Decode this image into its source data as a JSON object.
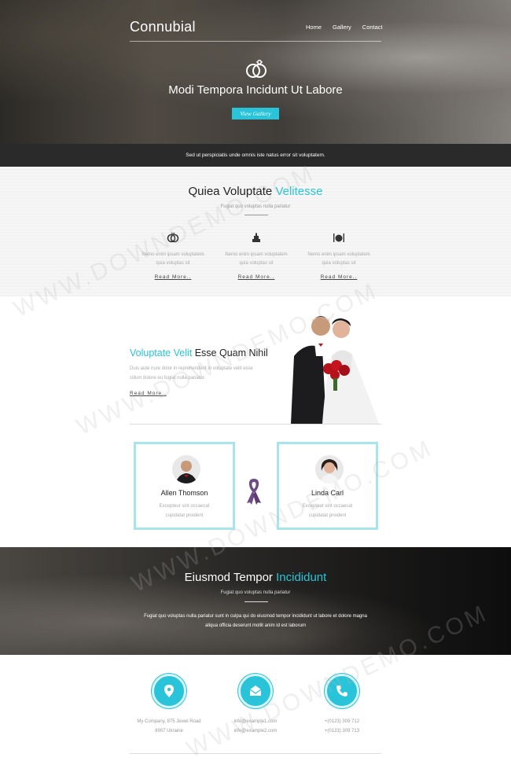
{
  "header": {
    "brand": "Connubial",
    "nav": [
      "Home",
      "Gallery",
      "Contact"
    ],
    "title": "Modi Tempora Incidunt Ut Labore",
    "button": "View Gallery",
    "tagline": "Sed ut perspiciatis unde omnis iste natus error sit voluptatem."
  },
  "services": {
    "title_main": "Quiea Voluptate",
    "title_accent": "Velitesse",
    "subtitle": "Fugiat quo voluptas nulla pariatur",
    "items": [
      {
        "icon": "rings-icon",
        "text_1": "Nemo enim ipsam voluptatem",
        "text_2": "quia voluptas sit",
        "link": "Read More.."
      },
      {
        "icon": "cake-icon",
        "text_1": "Nemo enim ipsam voluptatem",
        "text_2": "quia voluptas sit",
        "link": "Read More.."
      },
      {
        "icon": "dining-icon",
        "text_1": "Nemo enim ipsam voluptatem",
        "text_2": "quia voluptas sit",
        "link": "Read More.."
      }
    ]
  },
  "about": {
    "title_accent": "Voluptate Velit",
    "title_main": "Esse Quam Nihil",
    "text_1": "Duis aute irure dolor in reprehenderit in voluptate velit esse",
    "text_2": "cillum dolore eu fugiat nulla pariatur.",
    "link": "Read More.."
  },
  "profiles": [
    {
      "name": "Allen Thomson",
      "text_1": "Excepteur sint occaecat",
      "text_2": "cupidatat proident"
    },
    {
      "name": "Linda Carl",
      "text_1": "Excepteur sint occaecat",
      "text_2": "cupidatat proident"
    }
  ],
  "event": {
    "title_main": "Eiusmod Tempor",
    "title_accent": "Incididunt",
    "subtitle": "Fugiat quo voluptas nulla pariatur",
    "text_1": "Fugiat quo voluptas nulla pariatur sunt in culpa qui do eiusmod tempor incididunt ut labore et dolore magna",
    "text_2": "aliqua officia deserunt mollit anim id est laborum"
  },
  "contact": {
    "address_1": "My Company, 875 Jewel Road",
    "address_2": "8907 Ukraine",
    "email_1": "info@example1.com",
    "email_2": "info@example2.com",
    "phone_1": "+(0123) 309 712",
    "phone_2": "+(0123) 309 713"
  },
  "watermark": "WWW.DOWNDEMO.COM",
  "colors": {
    "accent": "#29c4d9",
    "dark_bar": "#2a2a2a",
    "card_border": "#a8e4ec"
  }
}
